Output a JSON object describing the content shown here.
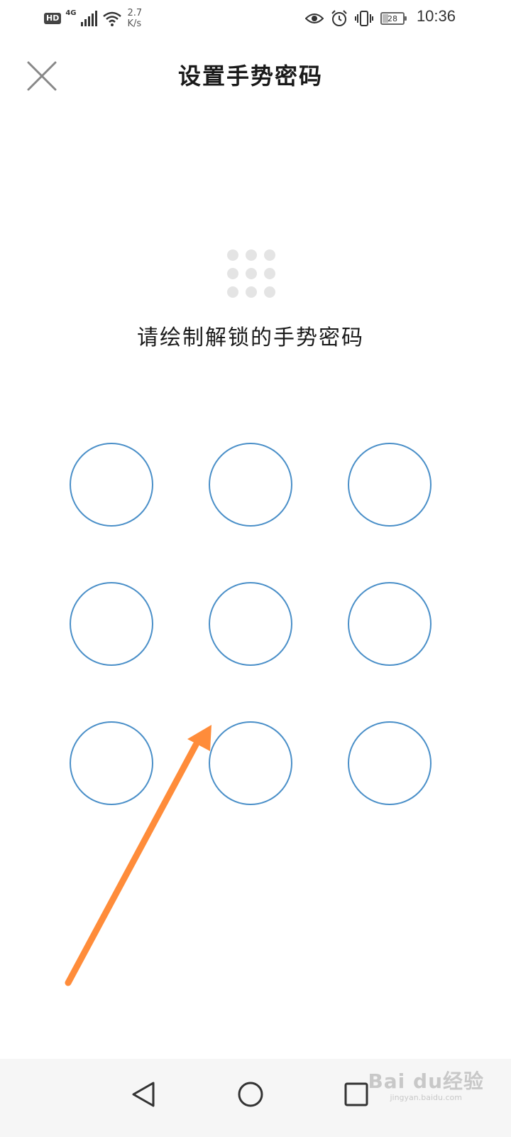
{
  "status_bar": {
    "hd_label": "HD",
    "network_type": "4G",
    "speed_value": "2.7",
    "speed_unit": "K/s",
    "battery_level": "28",
    "time": "10:36",
    "icons": [
      "signal-icon",
      "wifi-icon",
      "eye-icon",
      "alarm-icon",
      "vibrate-icon",
      "battery-icon"
    ]
  },
  "header": {
    "title": "设置手势密码",
    "close_icon": "close-icon"
  },
  "instruction": "请绘制解锁的手势密码",
  "pattern": {
    "rows": 3,
    "cols": 3,
    "node_color": "#4a8fc8"
  },
  "annotation": {
    "arrow_color": "#ff8c3a"
  },
  "nav_bar": {
    "back_icon": "back-triangle-icon",
    "home_icon": "home-circle-icon",
    "recents_icon": "recents-square-icon"
  },
  "watermark": {
    "text": "Bai du经验",
    "sub": "jingyan.baidu.com"
  }
}
